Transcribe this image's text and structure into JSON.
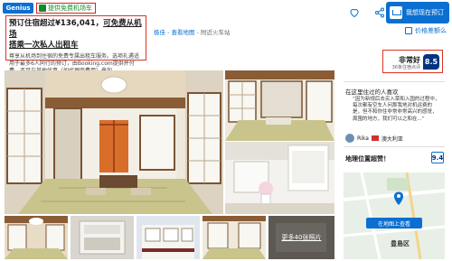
{
  "header": {
    "genius_badge": "Genius",
    "shuttle_tag": "提供免费机场车",
    "reserve_button": "我想现在预订"
  },
  "promo": {
    "title_line1": "预订住宿超过¥136,041，",
    "title_line1_highlight": "可免费从机场",
    "title_line2": "搭乘一次私人出租车",
    "body": "尊享从机场到住宿的免费专属出租车服务。选项礼遇适用于最多6人同行的预订，由Booking.com提供并付费。不可与其他优惠（如代理商费用）叠加。"
  },
  "address": {
    "link_text": "极佳 - 查看地图",
    "suffix": " - 附近火车站"
  },
  "price_match": "价格差额么",
  "gallery": {
    "more_photos": "更多40张照片"
  },
  "rating": {
    "word": "非常好",
    "count": "36条住宿点评",
    "score": "8.5"
  },
  "review": {
    "heading": "在这里住过的人喜欢",
    "text": "“因为新规后去买入菜和入国的过程中，每次都有空车人问那我地对机运费的是，但不和你住非常非常高兴的感觉，周围的地方，我们可以之和在...”",
    "reviewer_name": "Rika",
    "reviewer_country": "澳大利亚"
  },
  "location": {
    "label": "地理位置超赞！",
    "score": "9.4",
    "map_button": "在地图上查看",
    "district": "豊島区"
  },
  "colors": {
    "brand_blue": "#0a6fd1",
    "score_navy": "#003580",
    "annotation_red": "#d32"
  }
}
